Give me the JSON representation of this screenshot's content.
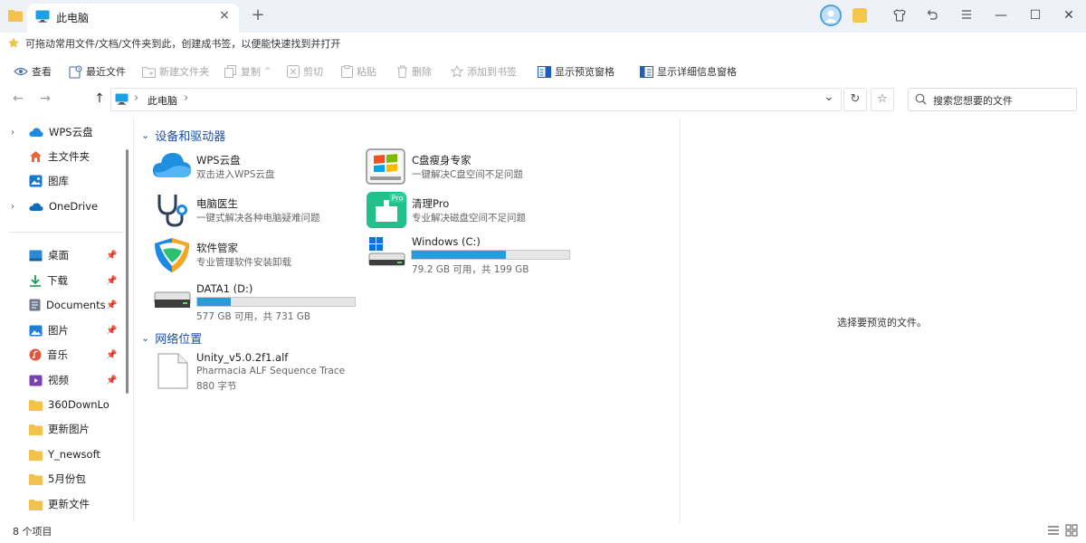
{
  "window": {
    "tab_title": "此电脑",
    "tab_close": "×",
    "new_tab": "+",
    "minimize": "—",
    "maximize": "☐",
    "close": "✕"
  },
  "bookmark_hint": "可拖动常用文件/文档/文件夹到此，创建成书签，以便能快速找到并打开",
  "toolbar": {
    "view": "查看",
    "recent": "最近文件",
    "new_folder": "新建文件夹",
    "copy": "复制",
    "copy_caret": "^",
    "cut": "剪切",
    "paste": "粘贴",
    "delete": "删除",
    "add_bookmark": "添加到书签",
    "show_preview": "显示预览窗格",
    "show_details": "显示详细信息窗格"
  },
  "address": {
    "path_label": "此电脑",
    "separator": "›",
    "back": "←",
    "forward": "→",
    "up": "↑",
    "dropdown": "⌄",
    "refresh": "↻",
    "bookmark": "☆"
  },
  "search": {
    "placeholder": "搜索您想要的文件"
  },
  "sidebar": {
    "items": [
      {
        "label": "WPS云盘"
      },
      {
        "label": "主文件夹"
      },
      {
        "label": "图库"
      },
      {
        "label": "OneDrive"
      },
      {
        "label": "桌面"
      },
      {
        "label": "下载"
      },
      {
        "label": "Documents"
      },
      {
        "label": "图片"
      },
      {
        "label": "音乐"
      },
      {
        "label": "视频"
      },
      {
        "label": "360DownLo"
      },
      {
        "label": "更新图片"
      },
      {
        "label": "Y_newsoft"
      },
      {
        "label": "5月份包"
      },
      {
        "label": "更新文件"
      }
    ]
  },
  "sections": {
    "devices": "设备和驱动器",
    "network": "网络位置"
  },
  "devices": {
    "wps": {
      "name": "WPS云盘",
      "desc": "双击进入WPS云盘"
    },
    "cdisk": {
      "name": "C盘瘦身专家",
      "desc": "一键解决C盘空间不足问题"
    },
    "doctor": {
      "name": "电脑医生",
      "desc": "一键式解决各种电脑疑难问题"
    },
    "cleaner": {
      "name": "清理Pro",
      "desc": "专业解决磁盘空间不足问题",
      "badge": "Pro"
    },
    "manager": {
      "name": "软件管家",
      "desc": "专业管理软件安装卸载"
    },
    "drive_c": {
      "name": "Windows (C:)",
      "desc": "79.2 GB 可用，共 199 GB",
      "used_fraction": 0.6
    },
    "drive_d": {
      "name": "DATA1 (D:)",
      "desc": "577 GB 可用，共 731 GB",
      "used_fraction": 0.21
    }
  },
  "network": {
    "file": {
      "name": "Unity_v5.0.2f1.alf",
      "type": "Pharmacia ALF Sequence Trace",
      "size": "880 字节"
    }
  },
  "preview": {
    "empty_text": "选择要预览的文件。"
  },
  "status": {
    "count": "8 个项目"
  },
  "colors": {
    "accent": "#2b9ad8",
    "section": "#1e4fa3",
    "folder": "#f2c14e"
  }
}
